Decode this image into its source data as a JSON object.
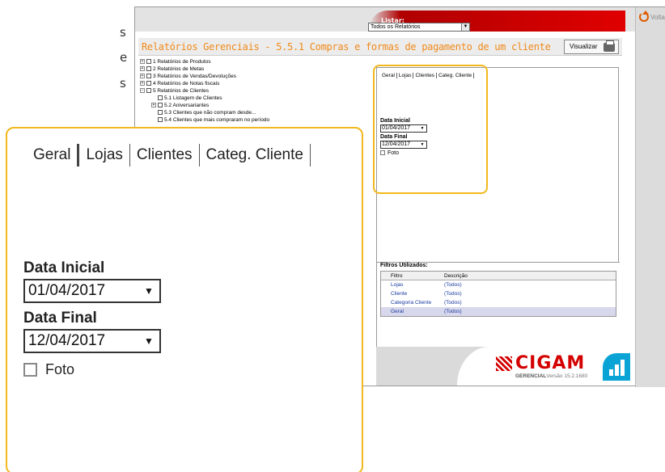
{
  "background_text": [
    "s",
    "e",
    "s"
  ],
  "app": {
    "listar": {
      "label": "Listar:",
      "selected": "Todos os Relatórios"
    },
    "voltar_label": "Volta",
    "report_title": "Relatórios Gerenciais - 5.5.1 Compras e formas de pagamento de um cliente",
    "visualizar_label": "Visualizar",
    "tree": [
      {
        "label": "1 Relatórios de Produtos",
        "expander": "+"
      },
      {
        "label": "2 Relatórios de Metas",
        "expander": "+"
      },
      {
        "label": "3 Relatórios de Vendas/Devoluções",
        "expander": "+"
      },
      {
        "label": "4 Relatórios de Notas fiscais",
        "expander": "+"
      },
      {
        "label": "5 Relatórios de Clientes",
        "expander": "−"
      },
      {
        "label": "5.1 Listagem de Clientes",
        "expander": ""
      },
      {
        "label": "5.2 Aniversariantes",
        "expander": "+"
      },
      {
        "label": "5.3 Clientes que não compram desde...",
        "expander": ""
      },
      {
        "label": "5.4 Clientes que mais compraram no período",
        "expander": ""
      }
    ],
    "tabs": [
      "Geral",
      "Lojas",
      "Clientes",
      "Categ. Cliente"
    ],
    "data_inicial_label": "Data Inicial",
    "data_inicial_value": "01/04/2017",
    "data_final_label": "Data Final",
    "data_final_value": "12/04/2017",
    "foto_label": "Foto",
    "filters": {
      "title": "Filtros Utilizados:",
      "col_filtro": "Filtro",
      "col_descricao": "Descrição",
      "rows": [
        {
          "filtro": "Lojas",
          "descricao": "(Todos)"
        },
        {
          "filtro": "Cliente",
          "descricao": "(Todos)"
        },
        {
          "filtro": "Categoria Cliente",
          "descricao": "(Todos)"
        },
        {
          "filtro": "Geral",
          "descricao": "(Todos)"
        }
      ]
    },
    "logo": {
      "name": "CIGAM",
      "sub": "GERENCIAL",
      "version": "Versão 15.2.1680"
    }
  },
  "zoom": {
    "tabs": [
      "Geral",
      "Lojas",
      "Clientes",
      "Categ. Cliente"
    ],
    "data_inicial_label": "Data Inicial",
    "data_inicial_value": "01/04/2017",
    "data_final_label": "Data Final",
    "data_final_value": "12/04/2017",
    "foto_label": "Foto"
  },
  "colors": {
    "highlight": "#f2b81e",
    "title_orange": "#f08a1a",
    "brand_red": "#d40000",
    "brand_blue": "#0aa3d6",
    "filter_text": "#1a3aa0"
  }
}
